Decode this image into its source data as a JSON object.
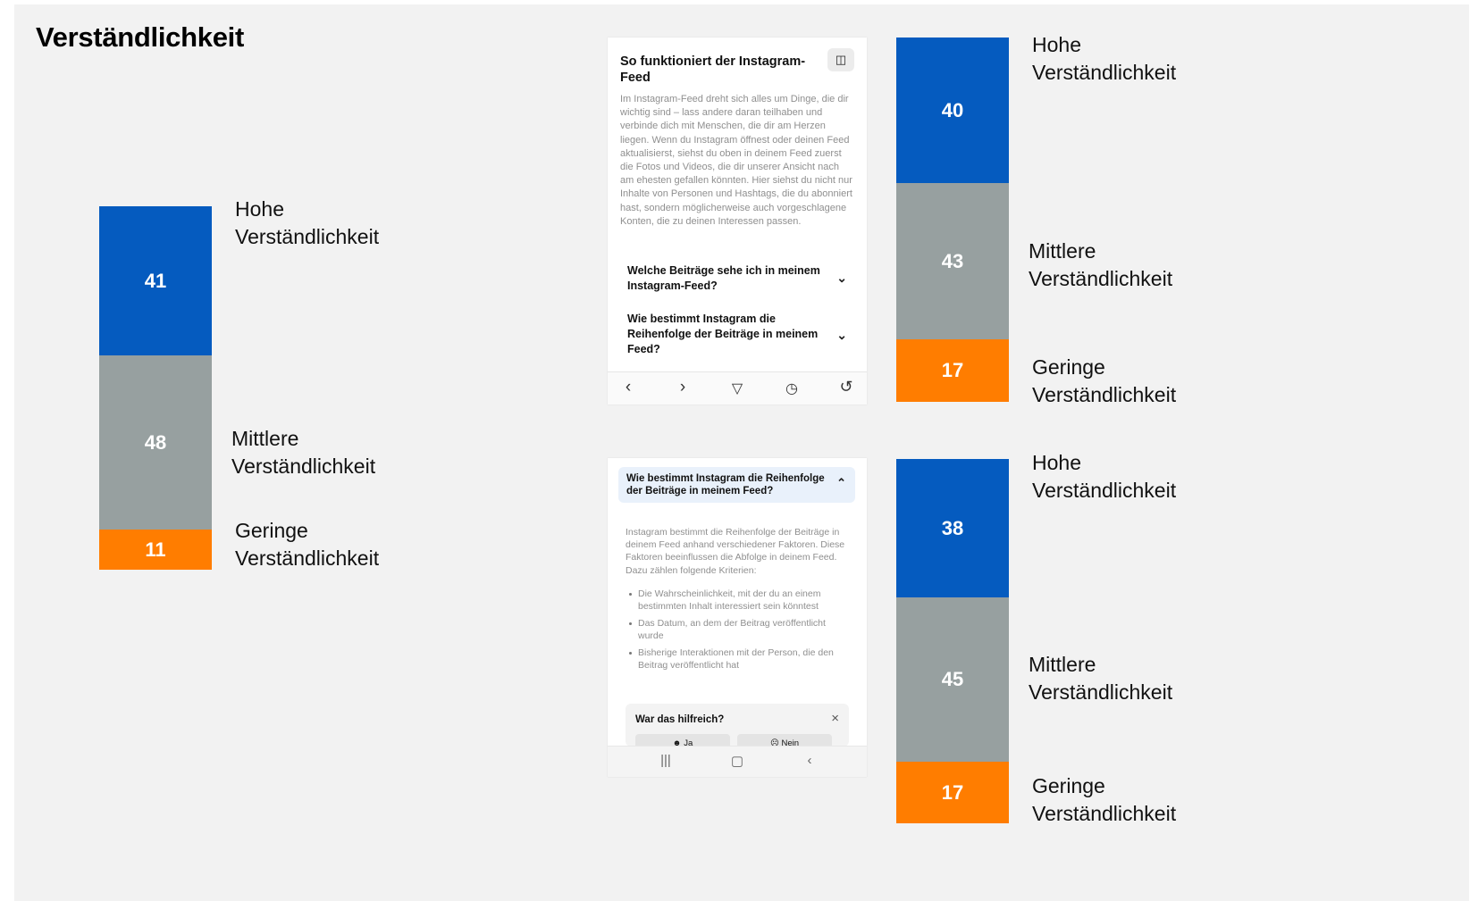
{
  "title": "Verständlichkeit",
  "colors": {
    "high": "#055bbf",
    "mid": "#97a0a0",
    "low": "#ff7d00",
    "background": "#f2f2f2"
  },
  "chart_data": [
    {
      "type": "bar",
      "stacked": true,
      "categories": [
        "Hohe Verständlichkeit",
        "Mittlere Verständlichkeit",
        "Geringe Verständlichkeit"
      ],
      "values": [
        41,
        48,
        11
      ],
      "labels": {
        "high": [
          "Hohe",
          "Verständlichkeit"
        ],
        "mid": [
          "Mittlere",
          "Verständlichkeit"
        ],
        "low": [
          "Geringe",
          "Verständlichkeit"
        ]
      }
    },
    {
      "type": "bar",
      "stacked": true,
      "categories": [
        "Hohe Verständlichkeit",
        "Mittlere Verständlichkeit",
        "Geringe Verständlichkeit"
      ],
      "values": [
        40,
        43,
        17
      ],
      "labels": {
        "high": [
          "Hohe",
          "Verständlichkeit"
        ],
        "mid": [
          "Mittlere",
          "Verständlichkeit"
        ],
        "low": [
          "Geringe",
          "Verständlichkeit"
        ]
      }
    },
    {
      "type": "bar",
      "stacked": true,
      "categories": [
        "Hohe Verständlichkeit",
        "Mittlere Verständlichkeit",
        "Geringe Verständlichkeit"
      ],
      "values": [
        38,
        45,
        17
      ],
      "labels": {
        "high": [
          "Hohe",
          "Verständlichkeit"
        ],
        "mid": [
          "Mittlere",
          "Verständlichkeit"
        ],
        "low": [
          "Geringe",
          "Verständlichkeit"
        ]
      }
    }
  ],
  "screen1": {
    "heading": "So funktioniert der Instagram-Feed",
    "copy_icon": "copy-icon",
    "body": "Im Instagram-Feed dreht sich alles um Dinge, die dir wichtig sind – lass andere daran teilhaben und verbinde dich mit Menschen, die dir am Herzen liegen. Wenn du Instagram öffnest oder deinen Feed aktualisierst, siehst du oben in deinem Feed zuerst die Fotos und Videos, die dir unserer Ansicht nach am ehesten gefallen könnten. Hier siehst du nicht nur Inhalte von Personen und Hashtags, die du abonniert hast, sondern möglicherweise auch vorgeschlagene Konten, die zu deinen Interessen passen.",
    "faq": [
      "Welche Beiträge sehe ich in meinem Instagram-Feed?",
      "Wie bestimmt Instagram die Reihenfolge der Beiträge in meinem Feed?"
    ],
    "nav_icons": [
      "back-icon",
      "forward-icon",
      "send-icon",
      "history-icon",
      "reload-icon"
    ]
  },
  "screen2": {
    "accordion_title": "Wie bestimmt Instagram die Reihenfolge der Beiträge in meinem Feed?",
    "body": "Instagram bestimmt die Reihenfolge der Beiträge in deinem Feed anhand verschiedener Faktoren. Diese Faktoren beeinflussen die Abfolge in deinem Feed. Dazu zählen folgende Kriterien:",
    "bullets": [
      "Die Wahrscheinlichkeit, mit der du an einem bestimmten Inhalt interessiert sein könntest",
      "Das Datum, an dem der Beitrag veröffentlicht wurde",
      "Bisherige Interaktionen mit der Person, die den Beitrag veröffentlicht hat"
    ],
    "feedback_question": "War das hilfreich?",
    "yes_label": "Ja",
    "no_label": "Nein"
  }
}
